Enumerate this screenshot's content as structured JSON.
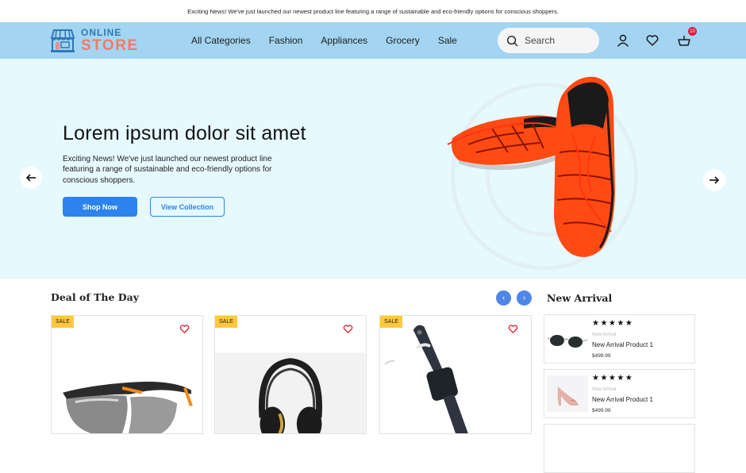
{
  "announcement": "Exciting News! We've just launched our newest product line featuring a range of sustainable and eco-friendly options for conscious shoppers.",
  "header": {
    "logo": {
      "line1": "ONLINE",
      "line2": "STORE"
    },
    "nav": [
      "All Categories",
      "Fashion",
      "Appliances",
      "Grocery",
      "Sale"
    ],
    "search_placeholder": "Search",
    "icons": [
      "user-icon",
      "heart-icon",
      "basket-icon"
    ],
    "cart_count": "10",
    "colors": {
      "header_bg": "#a3d5f2",
      "logo_primary": "#2f77b8",
      "logo_accent": "#f27a68",
      "badge": "#e0173f"
    }
  },
  "hero": {
    "title": "Lorem ipsum dolor sit amet",
    "description": "Exciting News! We've just launched our newest product line featuring a range of sustainable and eco-friendly options for conscious shoppers.",
    "primary_button": "Shop Now",
    "secondary_button": "View  Collection",
    "image": "orange running shoes",
    "prev_icon": "arrow-left-icon",
    "next_icon": "arrow-right-icon",
    "colors": {
      "bg": "#e6f9fe",
      "button": "#2b84ee"
    }
  },
  "deal_of_the_day": {
    "title": "Deal of The Day",
    "prev_icon": "chevron-left-icon",
    "next_icon": "chevron-right-icon",
    "products": [
      {
        "badge": "SALE",
        "image": "safety glasses"
      },
      {
        "badge": "SALE",
        "image": "headphones"
      },
      {
        "badge": "SALE",
        "image": "smart watch"
      }
    ],
    "colors": {
      "badge_bg": "#ffc93c",
      "heart": "#e0283a",
      "slider_btn": "#4e86e8"
    }
  },
  "new_arrival": {
    "title": "New Arrival",
    "items": [
      {
        "rating": "★★★★★",
        "category": "New Arrival",
        "name": "New Arrival Product 1",
        "price": "$499.99",
        "image": "sunglasses"
      },
      {
        "rating": "★★★★★",
        "category": "New Arrival",
        "name": "New Arrival Product 1",
        "price": "$499.99",
        "image": "pink heels"
      }
    ]
  }
}
